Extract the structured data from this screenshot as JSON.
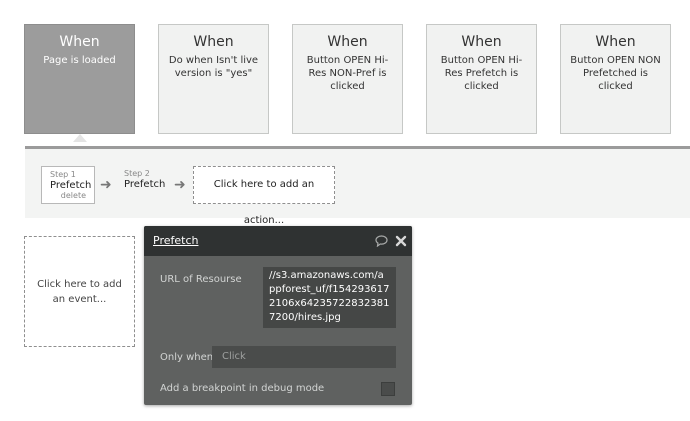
{
  "events": [
    {
      "title": "When",
      "description": "Page is loaded"
    },
    {
      "title": "When",
      "description": "Do when Isn't live version is \"yes\""
    },
    {
      "title": "When",
      "description": "Button OPEN Hi-Res NON-Pref is clicked"
    },
    {
      "title": "When",
      "description": "Button OPEN Hi-Res Prefetch is clicked"
    },
    {
      "title": "When",
      "description": "Button OPEN NON Prefetched is clicked"
    }
  ],
  "workflow": {
    "steps": [
      {
        "label": "Step 1",
        "name": "Prefetch",
        "delete_label": "delete"
      },
      {
        "label": "Step 2",
        "name": "Prefetch"
      }
    ],
    "add_action_label": "Click here to add an action..."
  },
  "add_event_label": "Click here to add an event...",
  "panel": {
    "title": "Prefetch",
    "url_label": "URL of Resourse",
    "url_value": "//s3.amazonaws.com/appforest_uf/f1542936172106x642357228323817200/hires.jpg",
    "only_when_label": "Only when",
    "only_when_placeholder": "Click",
    "breakpoint_label": "Add a breakpoint in debug mode"
  },
  "icons": {
    "arrow": "arrow-right-icon",
    "comment": "comment-icon",
    "close": "close-icon"
  },
  "colors": {
    "active_card": "#9c9c9c",
    "panel_bg": "#5f6160",
    "panel_header": "#2f3232"
  }
}
